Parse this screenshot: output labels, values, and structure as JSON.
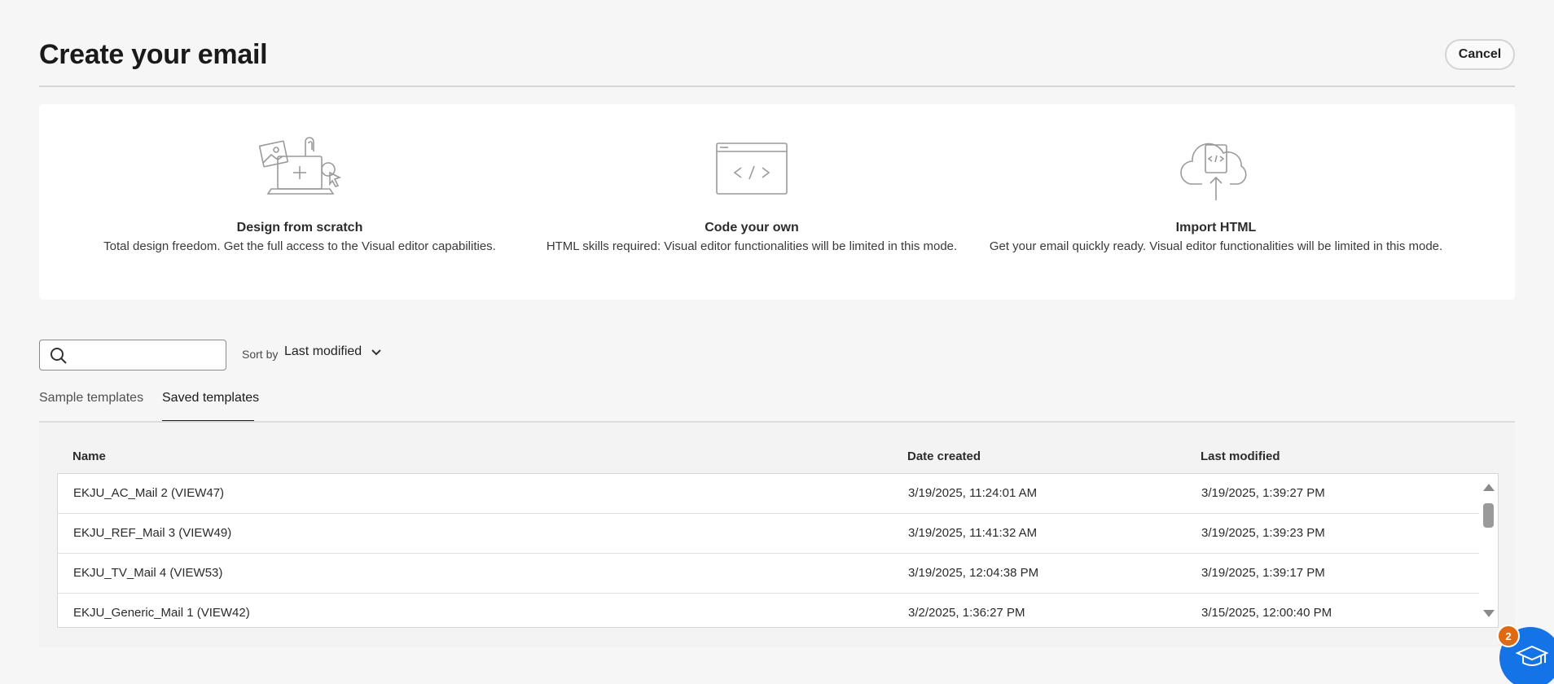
{
  "header": {
    "title": "Create your email",
    "cancel_label": "Cancel"
  },
  "options": [
    {
      "icon": "design-scratch-icon",
      "title": "Design from scratch",
      "description": "Total design freedom. Get the full access to the Visual editor capabilities."
    },
    {
      "icon": "code-window-icon",
      "title": "Code your own",
      "description": "HTML skills required: Visual editor functionalities will be limited in this mode."
    },
    {
      "icon": "cloud-upload-icon",
      "title": "Import HTML",
      "description": "Get your email quickly ready. Visual editor functionalities will be limited in this mode."
    }
  ],
  "search": {
    "placeholder": "",
    "value": ""
  },
  "sort": {
    "label": "Sort by",
    "value": "Last modified"
  },
  "tabs": [
    {
      "label": "Sample templates",
      "selected": false
    },
    {
      "label": "Saved templates",
      "selected": true
    }
  ],
  "table": {
    "columns": [
      "Name",
      "Date created",
      "Last modified"
    ],
    "rows": [
      {
        "name": "EKJU_AC_Mail 2 (VIEW47)",
        "created": "3/19/2025, 11:24:01 AM",
        "modified": "3/19/2025, 1:39:27 PM"
      },
      {
        "name": "EKJU_REF_Mail 3 (VIEW49)",
        "created": "3/19/2025, 11:41:32 AM",
        "modified": "3/19/2025, 1:39:23 PM"
      },
      {
        "name": "EKJU_TV_Mail 4 (VIEW53)",
        "created": "3/19/2025, 12:04:38 PM",
        "modified": "3/19/2025, 1:39:17 PM"
      },
      {
        "name": "EKJU_Generic_Mail 1 (VIEW42)",
        "created": "3/2/2025, 1:36:27 PM",
        "modified": "3/15/2025, 12:00:40 PM"
      }
    ]
  },
  "help": {
    "badge_count": "2",
    "icon": "graduation-cap-icon"
  },
  "colors": {
    "accent": "#1473e6",
    "badge": "#e06a12",
    "background": "#f6f6f6"
  }
}
